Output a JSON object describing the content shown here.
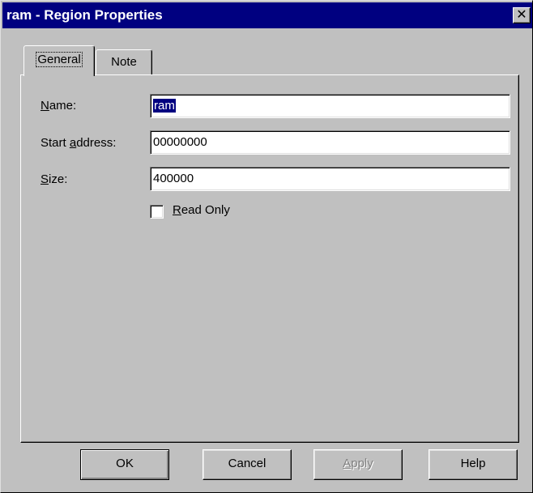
{
  "window": {
    "title": "ram - Region Properties",
    "close_glyph": "✕"
  },
  "tabs": [
    {
      "label": "General",
      "active": true
    },
    {
      "label": "Note",
      "active": false
    }
  ],
  "form": {
    "name": {
      "label_pre": "",
      "label_mnemonic": "N",
      "label_post": "ame:",
      "value": "ram"
    },
    "start_address": {
      "label_pre": "Start ",
      "label_mnemonic": "a",
      "label_post": "ddress:",
      "value": "00000000"
    },
    "size": {
      "label_pre": "",
      "label_mnemonic": "S",
      "label_post": "ize:",
      "value": "400000"
    },
    "read_only": {
      "label_mnemonic": "R",
      "label_post": "ead Only",
      "checked": false
    }
  },
  "buttons": {
    "ok": "OK",
    "cancel": "Cancel",
    "apply_mnemonic": "A",
    "apply_rest": "pply",
    "help": "Help"
  },
  "colors": {
    "titlebar": "#000080",
    "face": "#c0c0c0",
    "selection": "#000080"
  }
}
